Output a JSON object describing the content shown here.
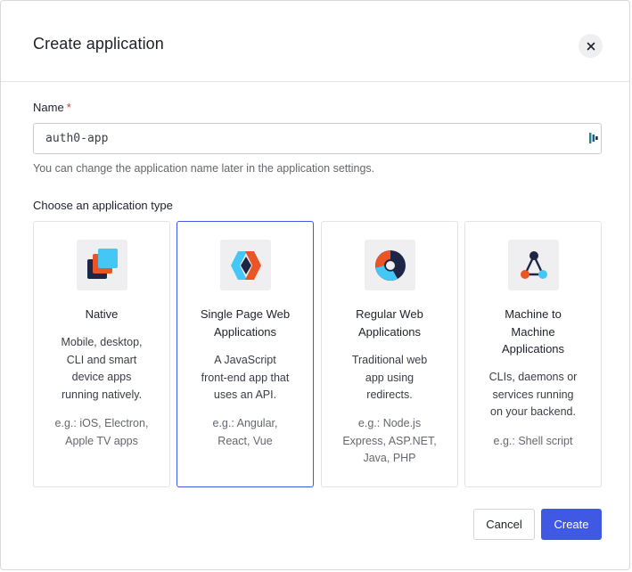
{
  "dialog": {
    "title": "Create application",
    "close_icon": "close-icon"
  },
  "form": {
    "name_label": "Name",
    "required_mark": "*",
    "name_value": "auth0-app",
    "name_hint": "You can change the application name later in the application settings.",
    "type_label": "Choose an application type"
  },
  "app_types": [
    {
      "name": "Native",
      "name_lines": [
        "Native"
      ],
      "desc_lines": [
        "Mobile, desktop,",
        "CLI and smart",
        "device apps",
        "running natively."
      ],
      "example_lines": [
        "e.g.: iOS, Electron,",
        "Apple TV apps"
      ],
      "icon": "native-icon",
      "selected": false
    },
    {
      "name": "Single Page Web Applications",
      "name_lines": [
        "Single Page Web",
        "Applications"
      ],
      "desc_lines": [
        "A JavaScript",
        "front-end app that",
        "uses an API."
      ],
      "example_lines": [
        "e.g.: Angular,",
        "React, Vue"
      ],
      "icon": "spa-icon",
      "selected": true
    },
    {
      "name": "Regular Web Applications",
      "name_lines": [
        "Regular Web",
        "Applications"
      ],
      "desc_lines": [
        "Traditional web",
        "app using",
        "redirects."
      ],
      "example_lines": [
        "e.g.: Node.js",
        "Express, ASP.NET,",
        "Java, PHP"
      ],
      "icon": "regular-web-icon",
      "selected": false
    },
    {
      "name": "Machine to Machine Applications",
      "name_lines": [
        "Machine to",
        "Machine",
        "Applications"
      ],
      "desc_lines": [
        "CLIs, daemons or",
        "services running",
        "on your backend."
      ],
      "example_lines": [
        "e.g.: Shell script"
      ],
      "icon": "machine-to-machine-icon",
      "selected": false
    }
  ],
  "actions": {
    "cancel_label": "Cancel",
    "create_label": "Create"
  },
  "colors": {
    "accent": "#3f59e4",
    "required": "#d03c38"
  }
}
